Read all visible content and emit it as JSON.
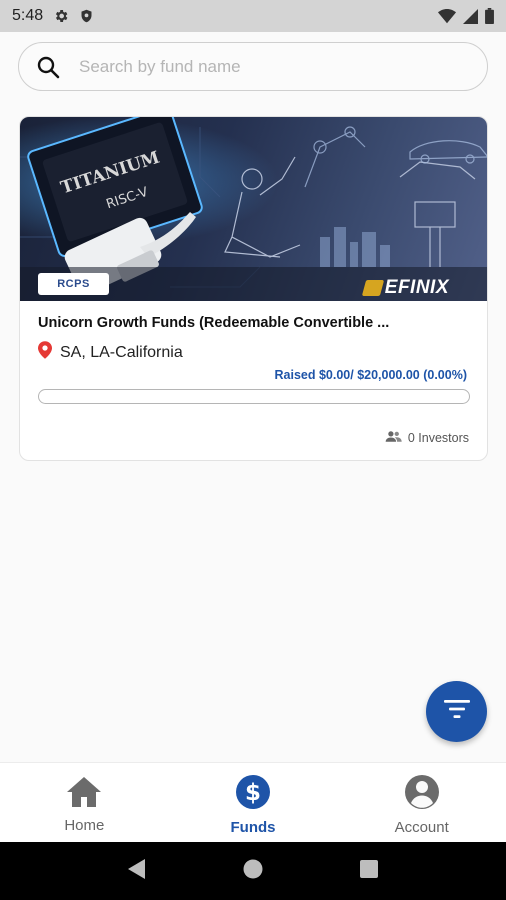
{
  "status_bar": {
    "time": "5:48",
    "icons": [
      "gear-icon",
      "shield-icon",
      "wifi-icon",
      "signal-icon",
      "battery-icon"
    ]
  },
  "search": {
    "placeholder": "Search by fund name",
    "value": ""
  },
  "funds": [
    {
      "badge": "RCPS",
      "banner_brand": "EFINIX",
      "title": "Unicorn Growth Funds (Redeemable Convertible ...",
      "location": "SA, LA-California",
      "raised_text": "Raised $0.00/ $20,000.00 (0.00%)",
      "progress_fraction": 0,
      "investors_text": "0 Investors"
    }
  ],
  "bottom_nav": {
    "items": [
      {
        "label": "Home",
        "icon": "home-icon",
        "active": false
      },
      {
        "label": "Funds",
        "icon": "dollar-circle-icon",
        "active": true
      },
      {
        "label": "Account",
        "icon": "account-circle-icon",
        "active": false
      }
    ]
  },
  "colors": {
    "accent": "#1e54a8",
    "location_pin": "#e53935"
  }
}
